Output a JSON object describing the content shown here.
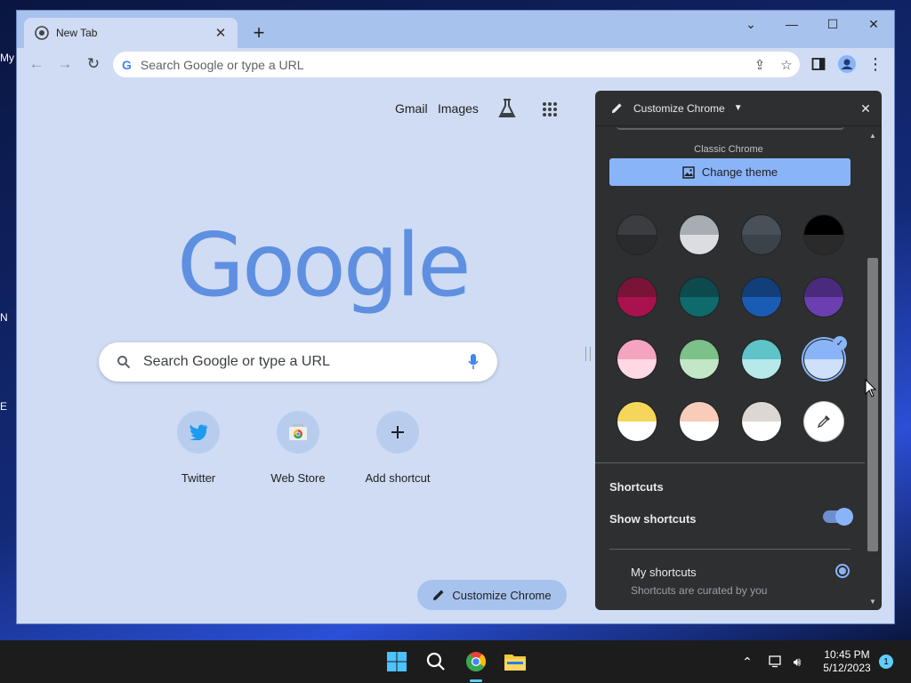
{
  "desktop": {
    "icon_labels": [
      "My",
      "N",
      "E"
    ]
  },
  "tab": {
    "title": "New Tab",
    "favicon": "chrome-icon",
    "close_icon": "close-icon"
  },
  "toolbar": {
    "omnibox_placeholder": "Search Google or type a URL"
  },
  "ntp": {
    "links": [
      "Gmail",
      "Images"
    ],
    "logo": "Google",
    "search_placeholder": "Search Google or type a URL",
    "shortcuts": [
      {
        "label": "Twitter",
        "icon": "twitter-icon"
      },
      {
        "label": "Web Store",
        "icon": "web-store-icon"
      },
      {
        "label": "Add shortcut",
        "icon": "plus-icon"
      }
    ],
    "customize_label": "Customize Chrome"
  },
  "side_panel": {
    "title": "Customize Chrome",
    "classic_label": "Classic Chrome",
    "change_theme_label": "Change theme",
    "swatches": [
      {
        "top": "#3c3d40",
        "bottom": "#2a2b2d"
      },
      {
        "top": "#a8acb3",
        "bottom": "#dcdde0"
      },
      {
        "top": "#485058",
        "bottom": "#3b4249"
      },
      {
        "top": "#000000",
        "bottom": "#2a2a2a"
      },
      {
        "top": "#7a1437",
        "bottom": "#a8124f"
      },
      {
        "top": "#0c4a4d",
        "bottom": "#0e6a6b"
      },
      {
        "top": "#123f7a",
        "bottom": "#1a5bb4"
      },
      {
        "top": "#4a2a7d",
        "bottom": "#6b3fb0"
      },
      {
        "top": "#f5a4bf",
        "bottom": "#ffd8e4"
      },
      {
        "top": "#7cc08a",
        "bottom": "#c2e6c6"
      },
      {
        "top": "#5ec4c8",
        "bottom": "#b7e8ea"
      },
      {
        "top": "#8ab4f8",
        "bottom": "#cfe0fb"
      },
      {
        "top": "#f6d65a",
        "bottom": "#ffffff"
      },
      {
        "top": "#f9ccba",
        "bottom": "#ffffff"
      },
      {
        "top": "#ddd7d3",
        "bottom": "#ffffff"
      },
      {
        "top": "#ffffff",
        "bottom": "#ffffff"
      }
    ],
    "selected_swatch_index": 11,
    "shortcuts_heading": "Shortcuts",
    "show_shortcuts_label": "Show shortcuts",
    "show_shortcuts_on": true,
    "my_shortcuts_label": "My shortcuts",
    "my_shortcuts_desc": "Shortcuts are curated by you"
  },
  "taskbar": {
    "time": "10:45 PM",
    "date": "5/12/2023",
    "notification_count": "1"
  },
  "colors": {
    "accent": "#8ab4f8",
    "page_bg": "#cfdcf3",
    "panel_bg": "#2d2f31"
  }
}
